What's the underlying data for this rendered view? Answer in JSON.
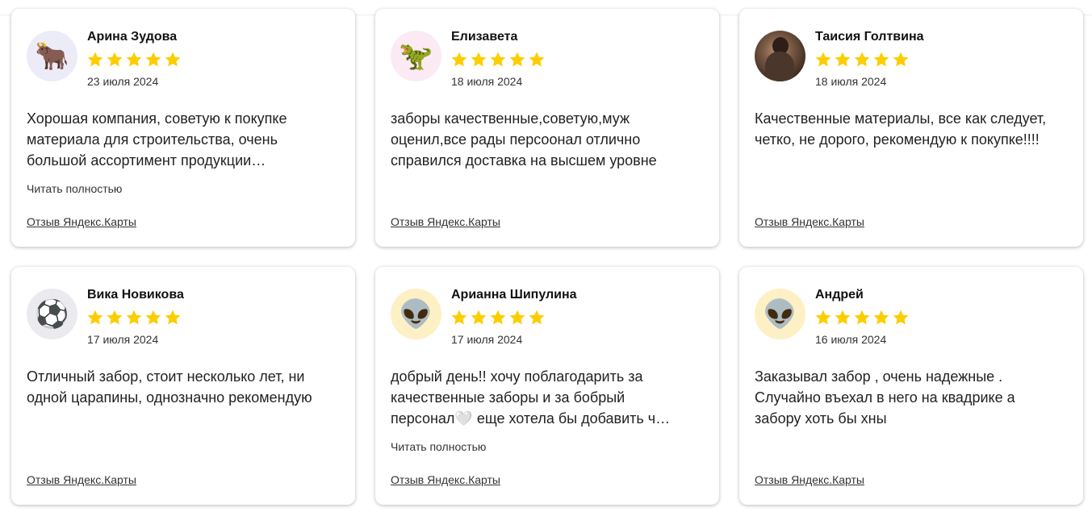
{
  "reviews": [
    {
      "name": "Арина Зудова",
      "rating": 5,
      "date": "23 июля 2024",
      "text": "Хорошая компания, советую к покупке материала для строительства, очень большой ассортимент продукции…",
      "read_more": "Читать полностью",
      "source": "Отзыв Яндекс.Карты",
      "avatar_icon": "ox-emoji-icon",
      "avatar_glyph": "🐂",
      "avatar_bg": "#ecebf8"
    },
    {
      "name": "Елизавета",
      "rating": 5,
      "date": "18 июля 2024",
      "text": "заборы качественные,советую,муж оценил,все рады персоонал отлично справился доставка на высшем уровне",
      "read_more": "",
      "source": "Отзыв Яндекс.Карты",
      "avatar_icon": "dinosaur-emoji-icon",
      "avatar_glyph": "🦖",
      "avatar_bg": "#fbe9f4"
    },
    {
      "name": "Таисия Голтвина",
      "rating": 5,
      "date": "18 июля 2024",
      "text": "Качественные материалы, все как следует, четко, не дорого, рекомендую к покупке!!!!",
      "read_more": "",
      "source": "Отзыв Яндекс.Карты",
      "avatar_icon": "user-photo-icon",
      "avatar_glyph": "",
      "avatar_bg": "#5a4233"
    },
    {
      "name": "Вика Новикова",
      "rating": 5,
      "date": "17 июля 2024",
      "text": "Отличный забор, стоит несколько лет, ни одной царапины, однозначно рекомендую",
      "read_more": "",
      "source": "Отзыв Яндекс.Карты",
      "avatar_icon": "soccer-ball-emoji-icon",
      "avatar_glyph": "⚽",
      "avatar_bg": "#ebebef"
    },
    {
      "name": "Арианна Шипулина",
      "rating": 5,
      "date": "17 июля 2024",
      "text": "добрый день!! хочу поблагодарить за качественные заборы и за бобрый персонал🤍 еще хотела бы добавить ч…",
      "read_more": "Читать полностью",
      "source": "Отзыв Яндекс.Карты",
      "avatar_icon": "alien-emoji-icon",
      "avatar_glyph": "👽",
      "avatar_bg": "#fdf0c4"
    },
    {
      "name": "Андрей",
      "rating": 5,
      "date": "16 июля 2024",
      "text": "Заказывал забор , очень надежные . Случайно въехал в него на квадрике а забору хоть бы хны",
      "read_more": "",
      "source": "Отзыв Яндекс.Карты",
      "avatar_icon": "alien-emoji-icon",
      "avatar_glyph": "👽",
      "avatar_bg": "#fdf0c4"
    }
  ],
  "colors": {
    "star": "#fccd00",
    "card_bg": "#ffffff",
    "text": "#222222"
  },
  "icons": {
    "star": "star-icon"
  }
}
